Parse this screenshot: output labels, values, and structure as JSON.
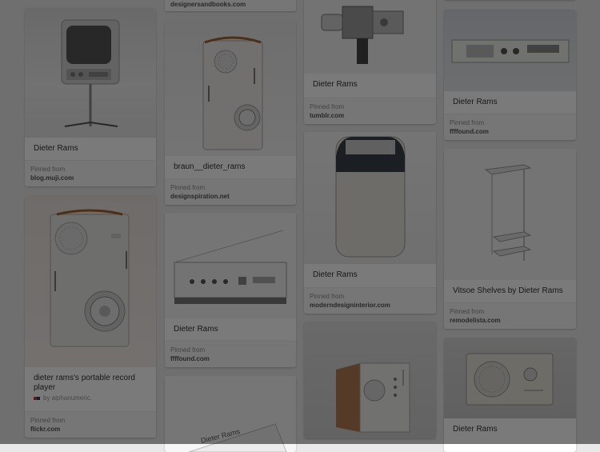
{
  "pins": [
    {
      "description": "",
      "pinned_label": "",
      "source": "designersandbooks.com"
    },
    {
      "description": "Dieter Rams",
      "pinned_label": "Pinned from",
      "source": "blog.muji.com",
      "image": "braun-tv-on-stand"
    },
    {
      "description": "dieter rams's portable record player",
      "pinner": "by alphanumeric.",
      "pinned_label": "Pinned from",
      "source": "flickr.com",
      "image": "braun-portable-record-player"
    },
    {
      "description": "braun__dieter_rams",
      "pinned_label": "Pinned from",
      "source": "designspiration.net",
      "image": "braun-portable-radio"
    },
    {
      "description": "Dieter Rams",
      "pinned_label": "Pinned from",
      "source": "ffffound.com",
      "image": "braun-hifi-control-unit"
    },
    {
      "description": "Dieter Rams",
      "pinned_label": "Pinned from",
      "source": "tumblr.com",
      "image": "braun-super-8-camera"
    },
    {
      "description": "Dieter Rams",
      "pinned_label": "Pinned from",
      "source": "moderndesigninterior.com",
      "image": "braun-shaver"
    },
    {
      "description": "",
      "pinned_label": "",
      "source": "",
      "image": "braun-radio-cube"
    },
    {
      "description": "Dieter Rams",
      "pinned_label": "Pinned from",
      "source": "ffffound.com",
      "image": "braun-wall-audio-unit"
    },
    {
      "description": "Vitsoe Shelves by Dieter Rams",
      "pinned_label": "Pinned from",
      "source": "remodelista.com",
      "image": "vitsoe-wall-shelf"
    },
    {
      "description": "Dieter Rams",
      "pinned_label": "",
      "source": "",
      "image": "braun-speaker-radio"
    }
  ],
  "book_cover_text": "Dieter Rams",
  "overlay_color": "#000000"
}
